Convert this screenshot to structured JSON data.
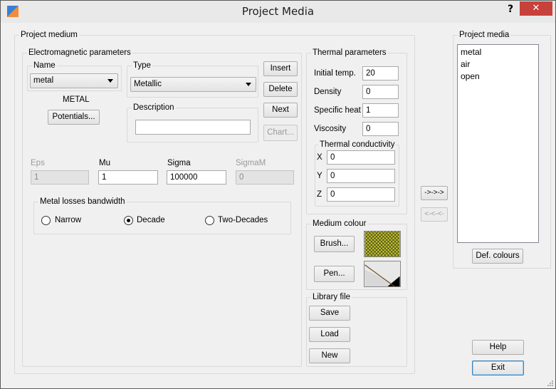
{
  "window": {
    "title": "Project Media",
    "help_label": "?",
    "close_label": "✕"
  },
  "project_medium": {
    "title": "Project medium",
    "em": {
      "title": "Electromagnetic parameters",
      "name_label": "Name",
      "name_value": "metal",
      "type_label": "Type",
      "type_value": "Metallic",
      "kind_label": "METAL",
      "potentials_label": "Potentials...",
      "description_label": "Description",
      "description_value": "",
      "insert_label": "Insert",
      "delete_label": "Delete",
      "next_label": "Next",
      "chart_label": "Chart...",
      "eps_label": "Eps",
      "eps_value": "1",
      "mu_label": "Mu",
      "mu_value": "1",
      "sigma_label": "Sigma",
      "sigma_value": "100000",
      "sigmam_label": "SigmaM",
      "sigmam_value": "0"
    },
    "losses": {
      "title": "Metal losses bandwidth",
      "options": [
        "Narrow",
        "Decade",
        "Two-Decades"
      ],
      "selected": "Decade"
    },
    "thermal": {
      "title": "Thermal parameters",
      "initial_temp_label": "Initial temp.",
      "initial_temp_value": "20",
      "density_label": "Density",
      "density_value": "0",
      "specific_heat_label": "Specific heat",
      "specific_heat_value": "1",
      "viscosity_label": "Viscosity",
      "viscosity_value": "0",
      "conductivity": {
        "title": "Thermal conductivity",
        "x_label": "X",
        "x_value": "0",
        "y_label": "Y",
        "y_value": "0",
        "z_label": "Z",
        "z_value": "0"
      }
    },
    "colour": {
      "title": "Medium colour",
      "brush_label": "Brush...",
      "pen_label": "Pen...",
      "brush_color": "#c8c832"
    },
    "library": {
      "title": "Library file",
      "save_label": "Save",
      "load_label": "Load",
      "new_label": "New"
    }
  },
  "transfer": {
    "add_label": "->->->",
    "remove_label": "<-<-<-"
  },
  "project_media": {
    "title": "Project media",
    "items": [
      "metal",
      "air",
      "open"
    ],
    "def_colours_label": "Def. colours"
  },
  "footer": {
    "help_label": "Help",
    "exit_label": "Exit"
  }
}
